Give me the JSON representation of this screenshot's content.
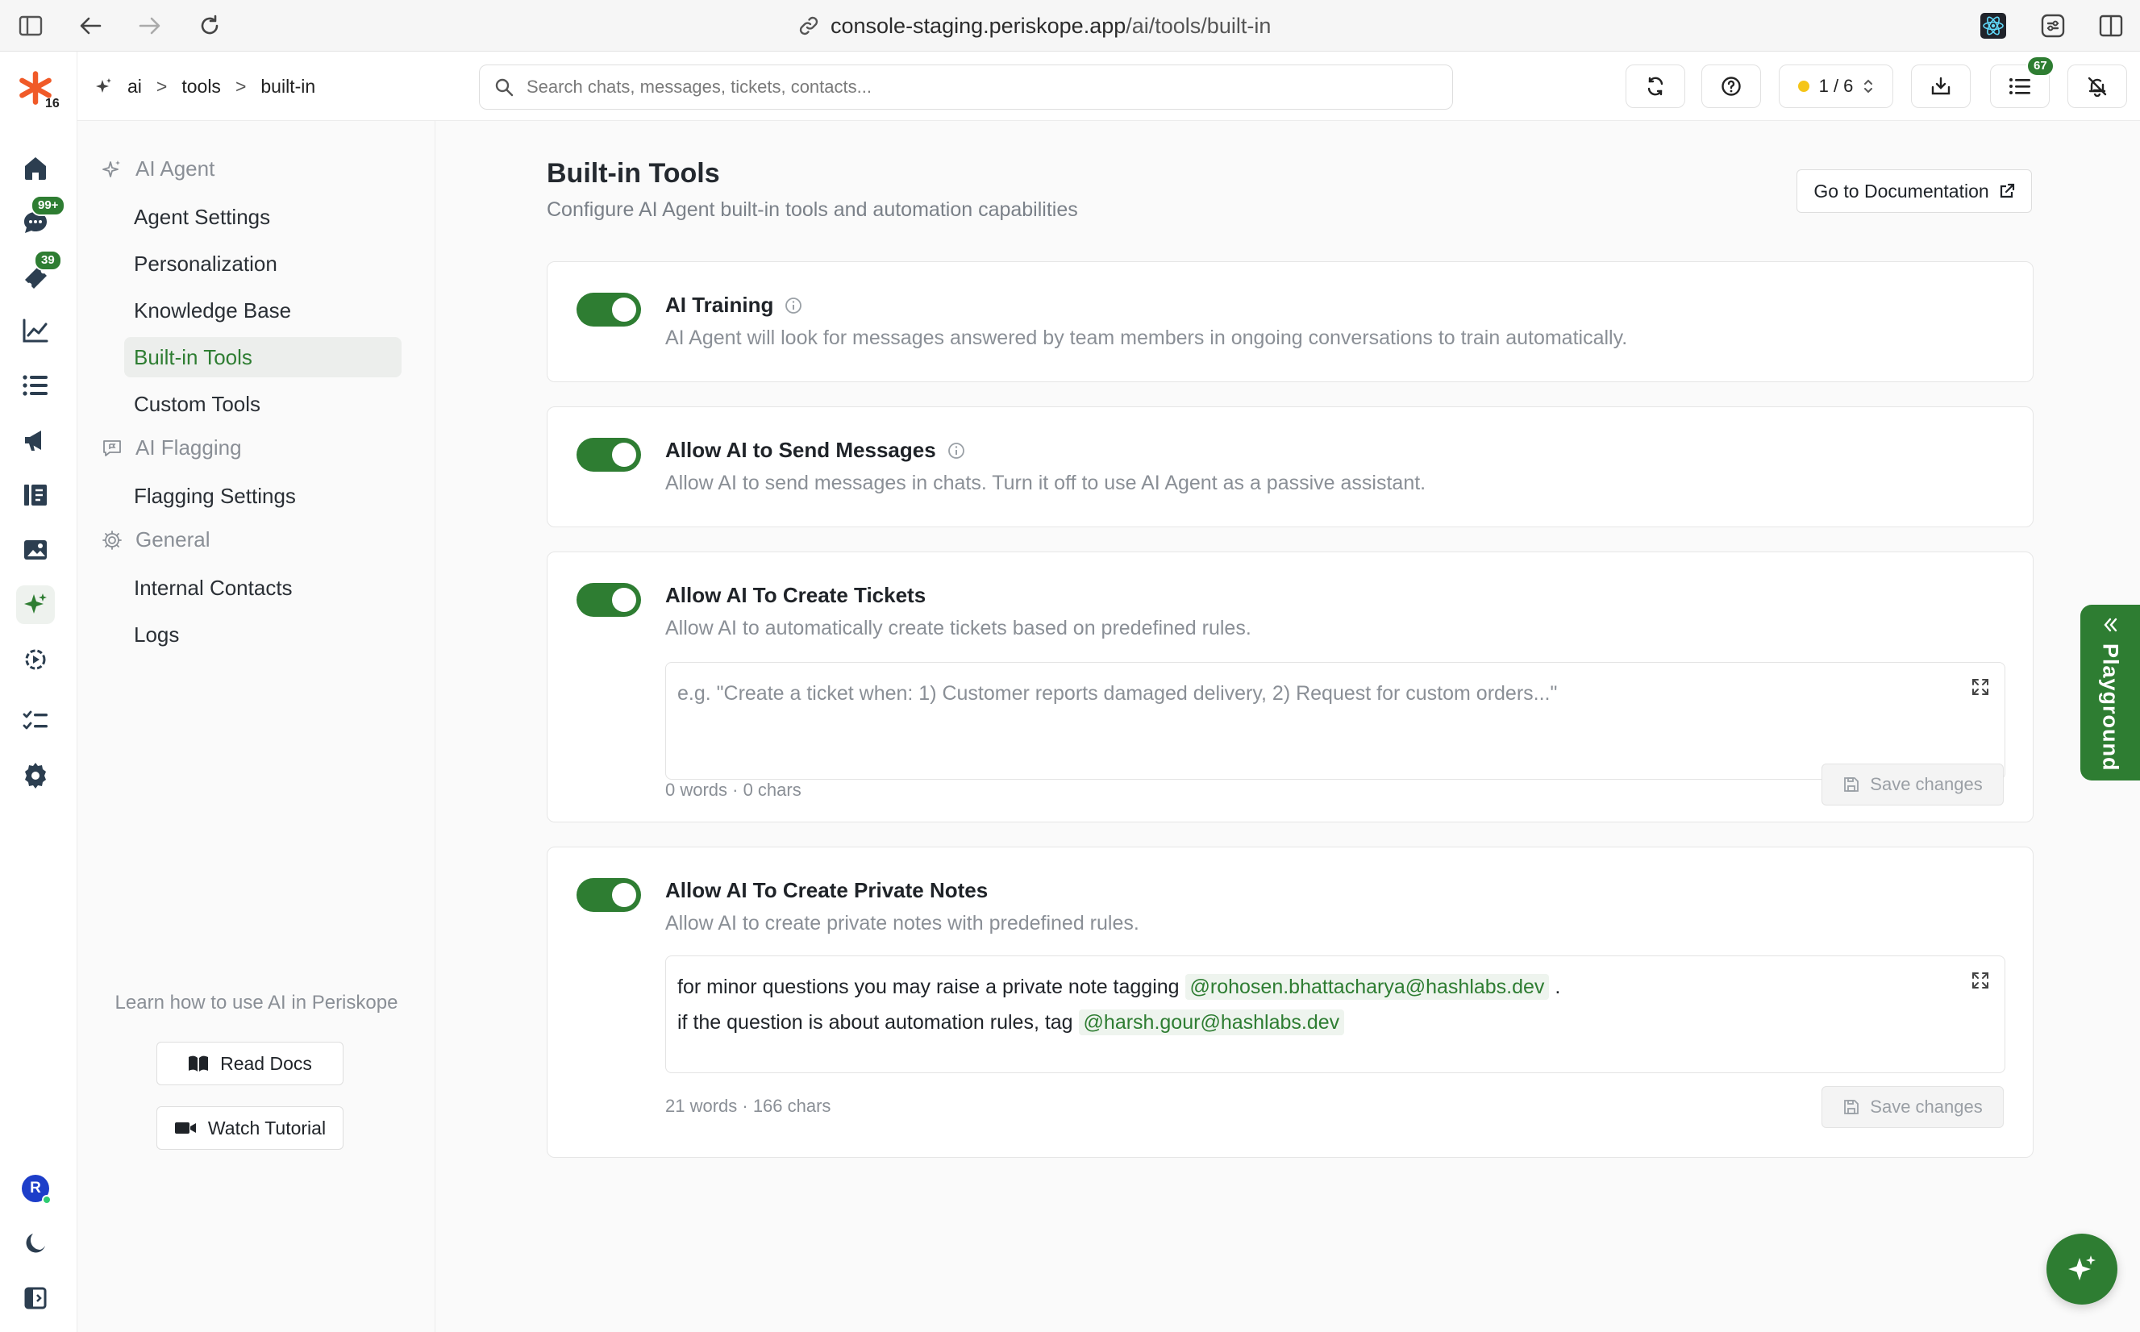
{
  "browser": {
    "url_host": "console-staging.periskope.app",
    "url_path": "/ai/tools/built-in"
  },
  "rail": {
    "logo_badge": "16",
    "chats_badge": "99+",
    "tickets_badge": "39",
    "avatar_letter": "R"
  },
  "header": {
    "breadcrumb": [
      "ai",
      "tools",
      "built-in"
    ],
    "breadcrumb_sep": ">",
    "search_placeholder": "Search chats, messages, tickets, contacts...",
    "phone_counter": "1 / 6",
    "tasks_badge": "67"
  },
  "sidebar": {
    "sections": [
      {
        "label": "AI Agent",
        "items": [
          "Agent Settings",
          "Personalization",
          "Knowledge Base",
          "Built-in Tools",
          "Custom Tools"
        ]
      },
      {
        "label": "AI Flagging",
        "items": [
          "Flagging Settings"
        ]
      },
      {
        "label": "General",
        "items": [
          "Internal Contacts",
          "Logs"
        ]
      }
    ],
    "active_item": "Built-in Tools",
    "learn_text": "Learn how to use AI in Periskope",
    "read_docs": "Read Docs",
    "watch_tutorial": "Watch Tutorial"
  },
  "main": {
    "title": "Built-in Tools",
    "subtitle": "Configure AI Agent built-in tools and automation capabilities",
    "doc_button": "Go to Documentation",
    "cards": [
      {
        "title": "AI Training",
        "desc": "AI Agent will look for messages answered by team members in ongoing conversations to train automatically.",
        "enabled": true
      },
      {
        "title": "Allow AI to Send Messages",
        "desc": "Allow AI to send messages in chats. Turn it off to use AI Agent as a passive assistant.",
        "enabled": true
      },
      {
        "title": "Allow AI To Create Tickets",
        "desc": "Allow AI to automatically create tickets based on predefined rules.",
        "enabled": true,
        "placeholder": "e.g. \"Create a ticket when: 1) Customer reports damaged delivery, 2) Request for custom orders...\"",
        "meta": "0 words · 0 chars",
        "save": "Save changes"
      },
      {
        "title": "Allow AI To Create Private Notes",
        "desc": "Allow AI to create private notes with predefined rules.",
        "enabled": true,
        "line1_text": "for minor questions you may raise a private note tagging",
        "line1_mention": "@rohosen.bhattacharya@hashlabs.dev",
        "line1_end": ".",
        "line2_text": "if the question is about automation rules, tag",
        "line2_mention": "@harsh.gour@hashlabs.dev",
        "meta": "21 words · 166 chars",
        "save": "Save changes"
      }
    ]
  },
  "playground_label": "Playground",
  "colors": {
    "accent": "#2e7d32",
    "muted": "#8a8f96"
  }
}
